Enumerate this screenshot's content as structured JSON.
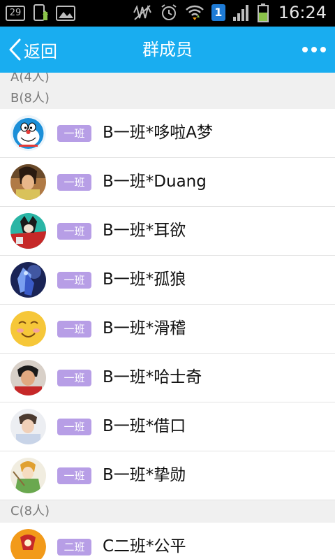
{
  "statusbar": {
    "date_badge": "29",
    "time": "16:24",
    "sim_badge": "1",
    "icons": [
      "calendar-icon",
      "download-icon",
      "image-icon",
      "mute-icon",
      "alarm-icon",
      "wifi-icon",
      "sim-icon",
      "signal-icon",
      "battery-icon"
    ]
  },
  "appbar": {
    "back_label": "返回",
    "title": "群成员",
    "more_icon": "more-dots-icon",
    "color": "#19adf0"
  },
  "sections": [
    {
      "header": "A(4人)"
    },
    {
      "header": "B(8人)",
      "members": [
        {
          "badge": "一班",
          "name": "B一班*哆啦A梦",
          "avatar": "doraemon"
        },
        {
          "badge": "一班",
          "name": "B一班*Duang",
          "avatar": "dark-hair-person"
        },
        {
          "badge": "一班",
          "name": "B一班*耳欲",
          "avatar": "red-character"
        },
        {
          "badge": "一班",
          "name": "B一班*孤狼",
          "avatar": "blue-armored-hero"
        },
        {
          "badge": "一班",
          "name": "B一班*滑稽",
          "avatar": "smiley-face"
        },
        {
          "badge": "一班",
          "name": "B一班*哈士奇",
          "avatar": "person-red-shirt"
        },
        {
          "badge": "一班",
          "name": "B一班*借口",
          "avatar": "person-light"
        },
        {
          "badge": "一班",
          "name": "B一班*挚勋",
          "avatar": "anime-character"
        }
      ]
    },
    {
      "header": "C(8人)",
      "members": [
        {
          "badge": "二班",
          "name": "C二班*公平",
          "avatar": "orange-character"
        }
      ]
    }
  ],
  "colors": {
    "badge": "#b79ee6",
    "section_text": "#7a7a7a"
  }
}
